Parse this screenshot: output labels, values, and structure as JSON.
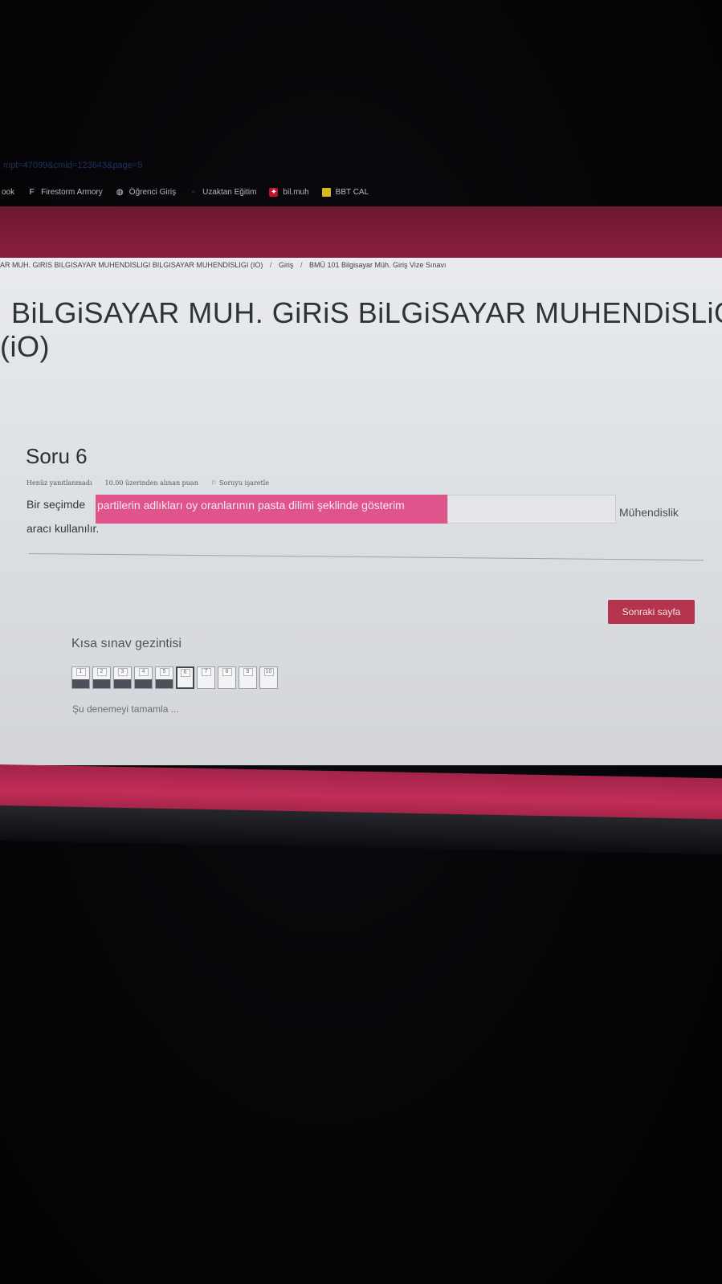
{
  "browser": {
    "url_fragment": "mpt=47099&cmid=123643&page=5",
    "bookmarks": [
      {
        "label": "ook",
        "icon": "none"
      },
      {
        "label": "Firestorm Armory",
        "icon": "firestorm-icon"
      },
      {
        "label": "Öğrenci Giriş",
        "icon": "globe-icon"
      },
      {
        "label": "Uzaktan Eğitim",
        "icon": "page-icon"
      },
      {
        "label": "bil.muh",
        "icon": "red-logo-icon"
      },
      {
        "label": "BBT CAL",
        "icon": "folder-icon"
      }
    ]
  },
  "breadcrumb": {
    "course": "AR MUH. GIRIS BILGISAYAR MUHENDISLIGI BILGISAYAR MUHENDISLIGI (IO)",
    "section": "Giriş",
    "quiz": "BMÜ 101 Bilgisayar Müh. Giriş Vize Sınavı",
    "separator": "/"
  },
  "page_title": {
    "line1": "BiLGiSAYAR MUH. GiRiS BiLGiSAYAR MUHENDiSLiGi",
    "line2": "(iO)"
  },
  "question": {
    "number_label": "Soru 6",
    "status": "Henüz yanıtlanmadı",
    "points": "10.00 üzerinden alınan puan",
    "flag_label": "Soruyu işaretle",
    "text_before": "Bir seçimde",
    "highlighted_text": "partilerin adlıkları oy oranlarının pasta dilimi şeklinde gösterim",
    "answer_value": "",
    "text_after": "Mühendislik",
    "text_line2": "aracı kullanılır."
  },
  "next_button": "Sonraki sayfa",
  "quiz_nav": {
    "title": "Kısa sınav gezintisi",
    "boxes": [
      {
        "label": "1",
        "state": "done"
      },
      {
        "label": "2",
        "state": "done"
      },
      {
        "label": "3",
        "state": "done"
      },
      {
        "label": "4",
        "state": "done"
      },
      {
        "label": "5",
        "state": "done"
      },
      {
        "label": "6",
        "state": "current"
      },
      {
        "label": "7",
        "state": "empty"
      },
      {
        "label": "8",
        "state": "empty"
      },
      {
        "label": "9",
        "state": "empty"
      },
      {
        "label": "10",
        "state": "empty"
      }
    ],
    "finish_link": "Şu denemeyi tamamla ..."
  },
  "colors": {
    "header": "#8a1f3d",
    "footer": "#c12e58",
    "highlight": "#e0548c",
    "button": "#b5344d",
    "page_bg": "#e9ebee"
  }
}
